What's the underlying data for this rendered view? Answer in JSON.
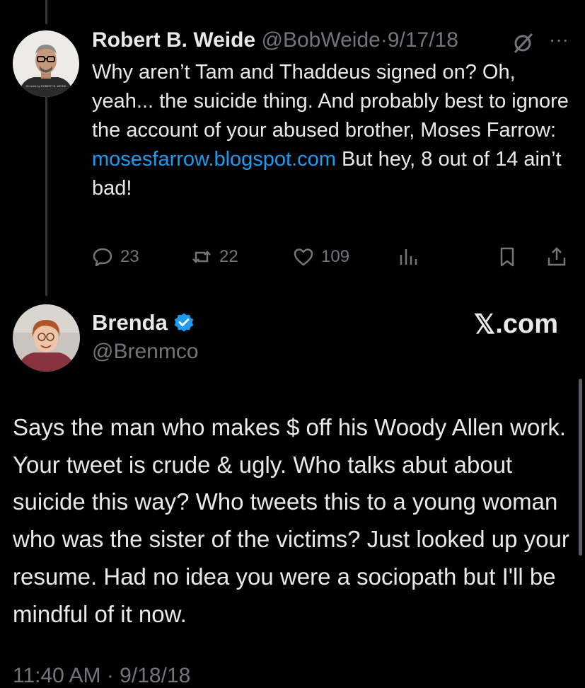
{
  "tweet1": {
    "name": "Robert B. Weide",
    "handle": "@BobWeide",
    "separator": "·",
    "date": "9/17/18",
    "more": "···",
    "text_before_link": "Why aren’t Tam and Thaddeus signed on? Oh, yeah... the suicide thing. And probably best to ignore the account of your abused brother, Moses Farrow: ",
    "link": "mosesfarrow.blogspot.com",
    "text_after_link": "  But hey, 8 out of 14 ain’t bad!",
    "avatar_shirt_text": "Directed by ROBERT B. WEIDE",
    "actions": {
      "replies": "23",
      "reposts": "22",
      "likes": "109"
    }
  },
  "tweet2": {
    "name": "Brenda",
    "handle": "@Brenmco",
    "text": "Says the man who makes $ off his Woody Allen work. Your tweet is crude & ugly.  Who talks abut about suicide this way?  Who tweets this to a young woman who was the sister of the victims? Just looked up your resume. Had no idea you were a sociopath but I'll be mindful of it now.",
    "timestamp": "11:40 AM · 9/18/18"
  },
  "branding": {
    "x_logo": "𝕏",
    "x_suffix": ".com"
  },
  "colors": {
    "background": "#000000",
    "text": "#e7e9ea",
    "muted": "#71767b",
    "link": "#1d9bf0",
    "verified": "#1d9bf0"
  },
  "icons": [
    "no-edit-icon",
    "more-icon",
    "reply-icon",
    "repost-icon",
    "like-icon",
    "views-icon",
    "bookmark-icon",
    "share-icon",
    "verified-badge-icon"
  ]
}
